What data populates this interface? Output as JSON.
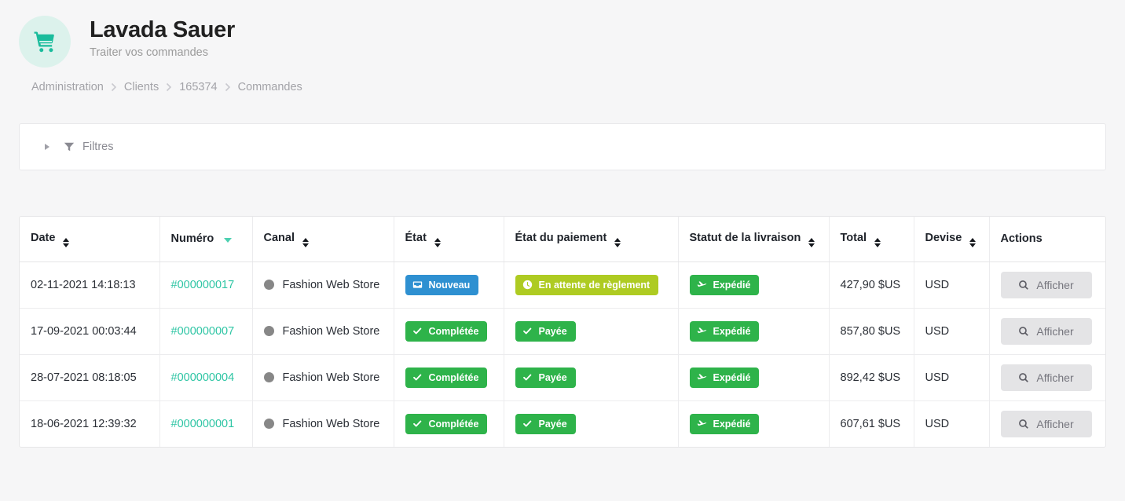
{
  "header": {
    "avatar_icon": "shopping-cart-icon",
    "title": "Lavada Sauer",
    "subtitle": "Traiter vos commandes"
  },
  "breadcrumb": {
    "items": [
      {
        "label": "Administration"
      },
      {
        "label": "Clients"
      },
      {
        "label": "165374"
      },
      {
        "label": "Commandes"
      }
    ]
  },
  "filters": {
    "label": "Filtres",
    "expanded": false,
    "icon": "filter-funnel-icon"
  },
  "table": {
    "columns": [
      {
        "label": "Date",
        "sortable": true,
        "sort": "none"
      },
      {
        "label": "Numéro",
        "sortable": true,
        "sort": "desc"
      },
      {
        "label": "Canal",
        "sortable": true,
        "sort": "none"
      },
      {
        "label": "État",
        "sortable": true,
        "sort": "none"
      },
      {
        "label": "État du paiement",
        "sortable": true,
        "sort": "none"
      },
      {
        "label": "Statut de la livraison",
        "sortable": true,
        "sort": "none"
      },
      {
        "label": "Total",
        "sortable": true,
        "sort": "none"
      },
      {
        "label": "Devise",
        "sortable": true,
        "sort": "none"
      },
      {
        "label": "Actions",
        "sortable": false,
        "sort": "none"
      }
    ],
    "rows": [
      {
        "date": "02-11-2021 14:18:13",
        "number": "#000000017",
        "channel": "Fashion Web Store",
        "state": {
          "label": "Nouveau",
          "color": "#2e90d1",
          "icon": "inbox-icon"
        },
        "payment": {
          "label": "En attente de règlement",
          "color": "#aecb22",
          "icon": "clock-icon"
        },
        "shipping": {
          "label": "Expédié",
          "color": "#2eb34a",
          "icon": "plane-icon"
        },
        "total": "427,90 $US",
        "currency": "USD",
        "action": "Afficher"
      },
      {
        "date": "17-09-2021 00:03:44",
        "number": "#000000007",
        "channel": "Fashion Web Store",
        "state": {
          "label": "Complétée",
          "color": "#2eb34a",
          "icon": "check-icon"
        },
        "payment": {
          "label": "Payée",
          "color": "#2eb34a",
          "icon": "check-icon"
        },
        "shipping": {
          "label": "Expédié",
          "color": "#2eb34a",
          "icon": "plane-icon"
        },
        "total": "857,80 $US",
        "currency": "USD",
        "action": "Afficher"
      },
      {
        "date": "28-07-2021 08:18:05",
        "number": "#000000004",
        "channel": "Fashion Web Store",
        "state": {
          "label": "Complétée",
          "color": "#2eb34a",
          "icon": "check-icon"
        },
        "payment": {
          "label": "Payée",
          "color": "#2eb34a",
          "icon": "check-icon"
        },
        "shipping": {
          "label": "Expédié",
          "color": "#2eb34a",
          "icon": "plane-icon"
        },
        "total": "892,42 $US",
        "currency": "USD",
        "action": "Afficher"
      },
      {
        "date": "18-06-2021 12:39:32",
        "number": "#000000001",
        "channel": "Fashion Web Store",
        "state": {
          "label": "Complétée",
          "color": "#2eb34a",
          "icon": "check-icon"
        },
        "payment": {
          "label": "Payée",
          "color": "#2eb34a",
          "icon": "check-icon"
        },
        "shipping": {
          "label": "Expédié",
          "color": "#2eb34a",
          "icon": "plane-icon"
        },
        "total": "607,61 $US",
        "currency": "USD",
        "action": "Afficher"
      }
    ]
  },
  "colors": {
    "accent_teal": "#2ec5a4",
    "badge_blue": "#2e90d1",
    "badge_olive": "#aecb22",
    "badge_green": "#2eb34a",
    "page_bg": "#f6f6f7"
  }
}
